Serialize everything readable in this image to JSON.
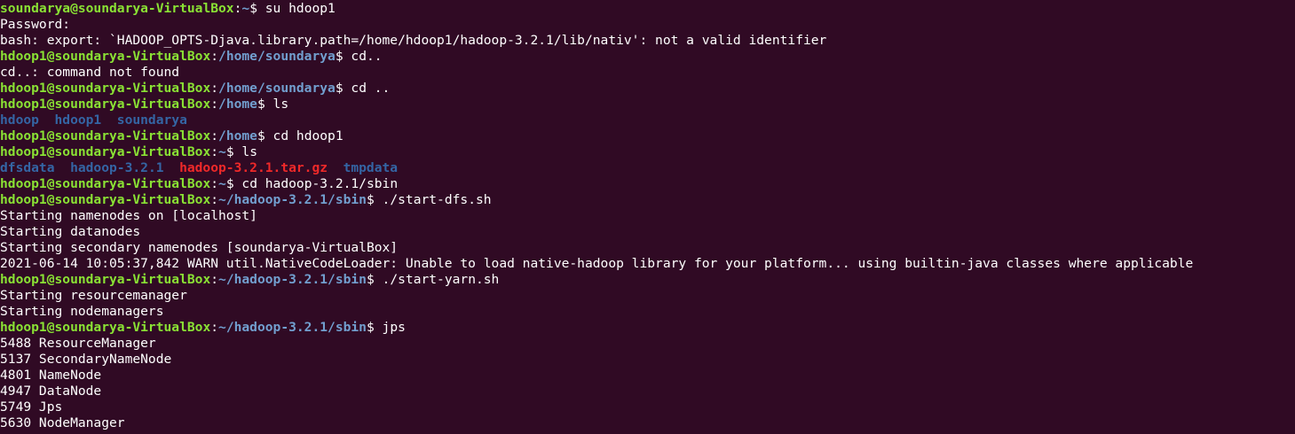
{
  "lines": [
    {
      "kind": "prompt",
      "user": "soundarya@soundarya-VirtualBox",
      "path": "~",
      "cmd": "su hdoop1"
    },
    {
      "kind": "text",
      "text": "Password:"
    },
    {
      "kind": "text",
      "text": "bash: export: `HADOOP_OPTS-Djava.library.path=/home/hdoop1/hadoop-3.2.1/lib/nativ': not a valid identifier"
    },
    {
      "kind": "prompt",
      "user": "hdoop1@soundarya-VirtualBox",
      "path": "/home/soundarya",
      "cmd": "cd.."
    },
    {
      "kind": "text",
      "text": "cd..: command not found"
    },
    {
      "kind": "prompt",
      "user": "hdoop1@soundarya-VirtualBox",
      "path": "/home/soundarya",
      "cmd": "cd .."
    },
    {
      "kind": "prompt",
      "user": "hdoop1@soundarya-VirtualBox",
      "path": "/home",
      "cmd": "ls"
    },
    {
      "kind": "listing",
      "items": [
        {
          "name": "hdoop",
          "type": "dir"
        },
        {
          "name": "hdoop1",
          "type": "dir"
        },
        {
          "name": "soundarya",
          "type": "dir"
        }
      ]
    },
    {
      "kind": "prompt",
      "user": "hdoop1@soundarya-VirtualBox",
      "path": "/home",
      "cmd": "cd hdoop1"
    },
    {
      "kind": "prompt",
      "user": "hdoop1@soundarya-VirtualBox",
      "path": "~",
      "cmd": "ls"
    },
    {
      "kind": "listing",
      "items": [
        {
          "name": "dfsdata",
          "type": "dir"
        },
        {
          "name": "hadoop-3.2.1",
          "type": "dir"
        },
        {
          "name": "hadoop-3.2.1.tar.gz",
          "type": "archive"
        },
        {
          "name": "tmpdata",
          "type": "dir"
        }
      ]
    },
    {
      "kind": "prompt",
      "user": "hdoop1@soundarya-VirtualBox",
      "path": "~",
      "cmd": "cd hadoop-3.2.1/sbin"
    },
    {
      "kind": "prompt",
      "user": "hdoop1@soundarya-VirtualBox",
      "path": "~/hadoop-3.2.1/sbin",
      "cmd": "./start-dfs.sh"
    },
    {
      "kind": "text",
      "text": "Starting namenodes on [localhost]"
    },
    {
      "kind": "text",
      "text": "Starting datanodes"
    },
    {
      "kind": "text",
      "text": "Starting secondary namenodes [soundarya-VirtualBox]"
    },
    {
      "kind": "text",
      "text": "2021-06-14 10:05:37,842 WARN util.NativeCodeLoader: Unable to load native-hadoop library for your platform... using builtin-java classes where applicable"
    },
    {
      "kind": "prompt",
      "user": "hdoop1@soundarya-VirtualBox",
      "path": "~/hadoop-3.2.1/sbin",
      "cmd": "./start-yarn.sh"
    },
    {
      "kind": "text",
      "text": "Starting resourcemanager"
    },
    {
      "kind": "text",
      "text": "Starting nodemanagers"
    },
    {
      "kind": "prompt",
      "user": "hdoop1@soundarya-VirtualBox",
      "path": "~/hadoop-3.2.1/sbin",
      "cmd": "jps"
    },
    {
      "kind": "text",
      "text": "5488 ResourceManager"
    },
    {
      "kind": "text",
      "text": "5137 SecondaryNameNode"
    },
    {
      "kind": "text",
      "text": "4801 NameNode"
    },
    {
      "kind": "text",
      "text": "4947 DataNode"
    },
    {
      "kind": "text",
      "text": "5749 Jps"
    },
    {
      "kind": "text",
      "text": "5630 NodeManager"
    }
  ],
  "colors": {
    "background": "#300a24",
    "user_host": "#8ae234",
    "path": "#729fcf",
    "directory": "#3465a4",
    "archive": "#ef2929",
    "text": "#ffffff"
  }
}
